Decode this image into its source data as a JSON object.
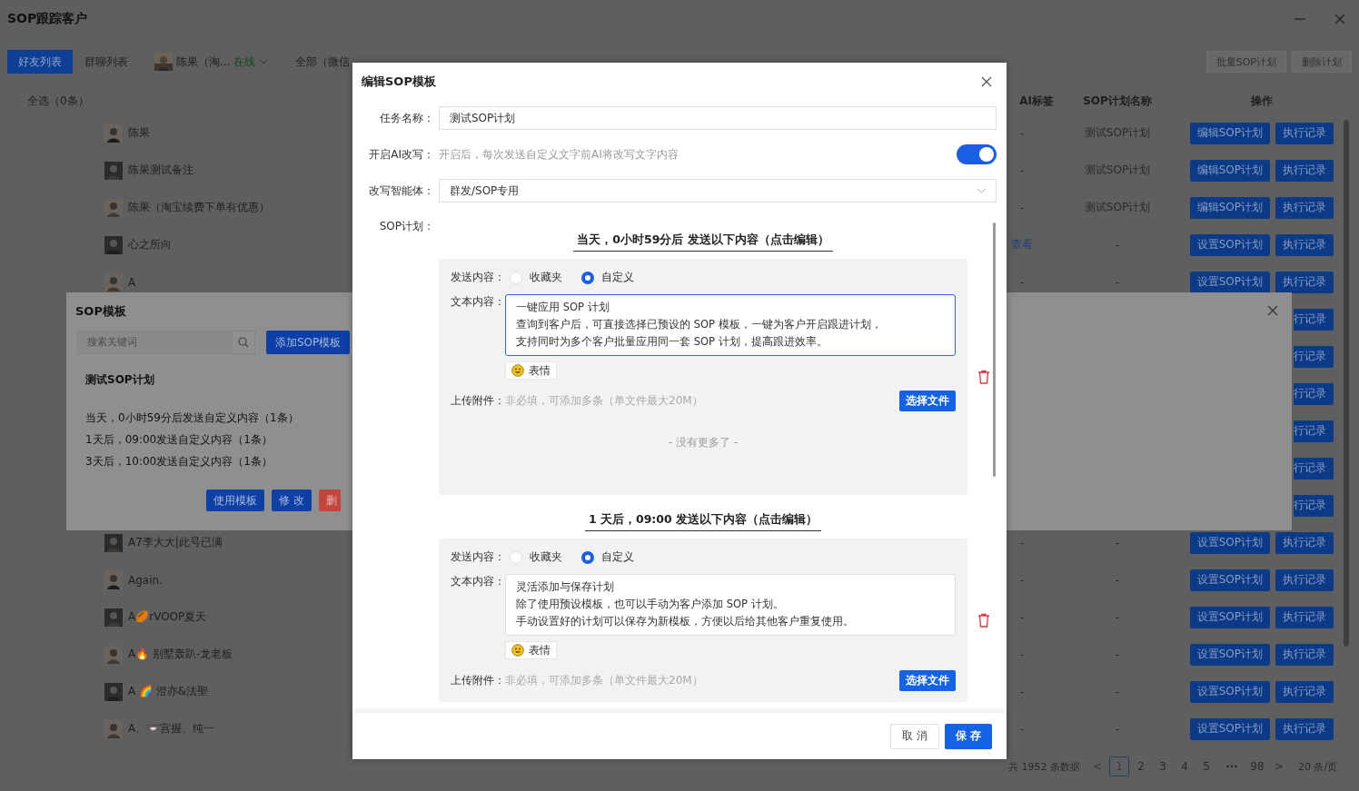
{
  "window": {
    "title": "SOP跟踪客户"
  },
  "toolbar": {
    "tabs": [
      {
        "label": "好友列表",
        "selected": true
      },
      {
        "label": "群聊列表",
        "selected": false
      }
    ],
    "account": {
      "name": "陈果（淘...",
      "status": "在线"
    },
    "filter": "全部（微信",
    "actions": [
      "批量SOP计划",
      "删除计划"
    ]
  },
  "table": {
    "select_all": "全选（0条）",
    "columns": [
      "AI标签",
      "SOP计划名称",
      "操作"
    ],
    "rows": [
      {
        "name": "陈果",
        "ai_tag": "-",
        "ai_tag_link": false,
        "plan": "测试SOP计划",
        "actions": [
          "编辑SOP计划",
          "执行记录"
        ]
      },
      {
        "name": "陈果测试备注",
        "ai_tag": "-",
        "ai_tag_link": false,
        "plan": "测试SOP计划",
        "actions": [
          "编辑SOP计划",
          "执行记录"
        ]
      },
      {
        "name": "陈果（淘宝续费下单有优惠）",
        "ai_tag": "-",
        "ai_tag_link": false,
        "plan": "测试SOP计划",
        "actions": [
          "编辑SOP计划",
          "执行记录"
        ]
      },
      {
        "name": "心之所向",
        "ai_tag": "查看",
        "ai_tag_link": true,
        "plan": "-",
        "actions": [
          "设置SOP计划",
          "执行记录"
        ]
      },
      {
        "name": "A",
        "ai_tag": "-",
        "ai_tag_link": false,
        "plan": "-",
        "actions": [
          "设置SOP计划",
          "执行记录"
        ]
      },
      {
        "actions": [
          "行记录"
        ]
      },
      {
        "actions": [
          "行记录"
        ]
      },
      {
        "actions": [
          "行记录"
        ]
      },
      {
        "actions": [
          "行记录"
        ]
      },
      {
        "actions": [
          "行记录"
        ]
      },
      {
        "actions": [
          "行记录"
        ]
      },
      {
        "name": "A7李大大|此号已满",
        "ai_tag": "-",
        "ai_tag_link": false,
        "plan": "-",
        "actions": [
          "设置SOP计划",
          "执行记录"
        ]
      },
      {
        "name": "Again.",
        "ai_tag": "-",
        "ai_tag_link": false,
        "plan": "-",
        "actions": [
          "设置SOP计划",
          "执行记录"
        ]
      },
      {
        "name": "A🏉rVOOP夏天",
        "ai_tag": "-",
        "ai_tag_link": false,
        "plan": "-",
        "actions": [
          "设置SOP计划",
          "执行记录"
        ]
      },
      {
        "name": "A🔥 别墅轰趴-龙老板",
        "ai_tag": "-",
        "ai_tag_link": false,
        "plan": "-",
        "actions": [
          "设置SOP计划",
          "执行记录"
        ]
      },
      {
        "name": "A 🌈 澄亦&法聖",
        "ai_tag": "-",
        "ai_tag_link": false,
        "plan": "-",
        "actions": [
          "设置SOP计划",
          "执行记录"
        ]
      },
      {
        "name": "A、📼宫握、纯一",
        "ai_tag": "-",
        "ai_tag_link": false,
        "plan": "-",
        "actions": [
          "设置SOP计划",
          "执行记录"
        ]
      }
    ]
  },
  "pagination": {
    "total": "共 1952 条数据",
    "prev": {
      "label": "<",
      "disabled": true
    },
    "pages": [
      {
        "label": "1",
        "selected": true
      },
      {
        "label": "2",
        "selected": false
      },
      {
        "label": "3",
        "selected": false
      },
      {
        "label": "4",
        "selected": false
      },
      {
        "label": "5",
        "selected": false
      }
    ],
    "ellipsis": "···",
    "last": "98",
    "next": {
      "label": ">",
      "disabled": false
    },
    "page_size": "20 条/页"
  },
  "template_dialog": {
    "title": "SOP模板",
    "search_placeholder": "搜索关键词",
    "add_button": "添加SOP模板",
    "template": {
      "name": "测试SOP计划",
      "steps": [
        "当天，0小时59分后发送自定义内容（1条）",
        "1天后，09:00发送自定义内容（1条）",
        "3天后，10:00发送自定义内容（1条）"
      ],
      "buttons": [
        {
          "label": "使用模板",
          "kind": "primary"
        },
        {
          "label": "修 改",
          "kind": "primary"
        },
        {
          "label": "删",
          "kind": "danger"
        }
      ]
    }
  },
  "edit_dialog": {
    "title": "编辑SOP模板",
    "task_name": {
      "label": "任务名称：",
      "value": "测试SOP计划"
    },
    "ai_rewrite": {
      "label": "开启AI改写：",
      "hint": "开启后，每次发送自定义文字前AI将改写文字内容",
      "on": true
    },
    "agent": {
      "label": "改写智能体：",
      "value": "群发/SOP专用"
    },
    "plan_label": "SOP计划：",
    "steps": [
      {
        "heading": "当天，0小时59分后 发送以下内容（点击编辑）",
        "send_label": "发送内容：",
        "options": [
          {
            "label": "收藏夹",
            "selected": false
          },
          {
            "label": "自定义",
            "selected": true
          }
        ],
        "text_label": "文本内容：",
        "text": [
          "一键应用 SOP 计划",
          "查询到客户后，可直接选择已预设的 SOP 模板，一键为客户开启跟进计划，",
          "支持同时为多个客户批量应用同一套 SOP 计划，提高跟进效率。"
        ],
        "focused": true,
        "emoji_button": "表情",
        "upload_label": "上传附件：",
        "upload_hint": "非必填，可添加多条（单文件最大20M）",
        "file_button": "选择文件",
        "note": "- 没有更多了 -"
      },
      {
        "heading": "1 天后，09:00 发送以下内容（点击编辑）",
        "send_label": "发送内容：",
        "options": [
          {
            "label": "收藏夹",
            "selected": false
          },
          {
            "label": "自定义",
            "selected": true
          }
        ],
        "text_label": "文本内容：",
        "text": [
          "灵活添加与保存计划",
          "除了使用预设模板，也可以手动为客户添加 SOP 计划。",
          "手动设置好的计划可以保存为新模板，方便以后给其他客户重复使用。"
        ],
        "focused": false,
        "emoji_button": "表情",
        "upload_label": "上传附件：",
        "upload_hint": "非必填，可添加多条（单文件最大20M）",
        "file_button": "选择文件"
      }
    ],
    "cancel": "取 消",
    "save": "保 存"
  }
}
